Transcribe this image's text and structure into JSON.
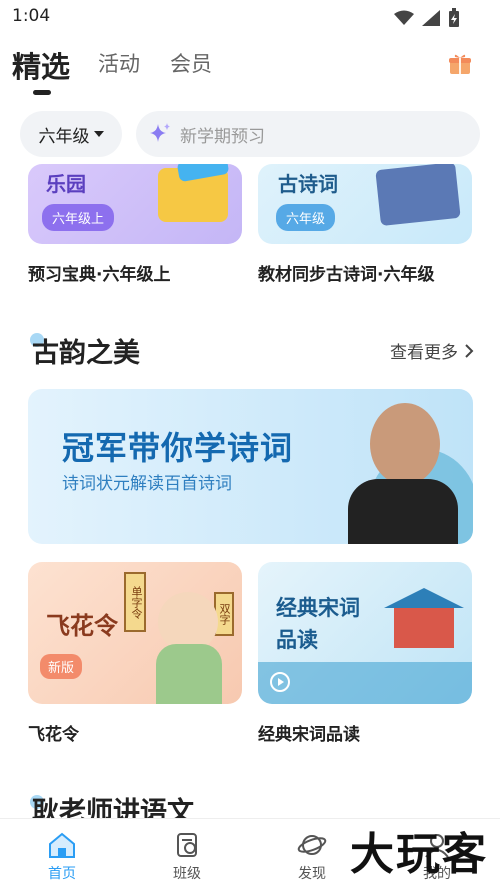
{
  "status": {
    "time": "1:04"
  },
  "topnav": {
    "tabs": [
      {
        "label": "精选",
        "active": true
      },
      {
        "label": "活动",
        "active": false
      },
      {
        "label": "会员",
        "active": false
      }
    ]
  },
  "filter": {
    "grade": "六年级",
    "search_placeholder": "新学期预习"
  },
  "top_cards": [
    {
      "banner_title": "乐园",
      "badge": "六年级上",
      "caption": "预习宝典·六年级上"
    },
    {
      "banner_title": "古诗词",
      "badge": "六年级",
      "caption": "教材同步古诗词·六年级"
    }
  ],
  "section_gu": {
    "title": "古韵之美",
    "more": "查看更多",
    "banner": {
      "title": "冠军带你学诗词",
      "subtitle": "诗词状元解读百首诗词"
    },
    "cards": [
      {
        "banner_title": "飞花令",
        "tag1": "单字令",
        "tag2": "双字",
        "badge": "新版",
        "caption": "飞花令"
      },
      {
        "banner_title_1": "经典宋词",
        "banner_title_2": "品读",
        "caption": "经典宋词品读"
      }
    ]
  },
  "section_geng": {
    "title": "耿老师讲语文"
  },
  "tabbar": {
    "items": [
      {
        "label": "首页",
        "active": true
      },
      {
        "label": "班级",
        "active": false
      },
      {
        "label": "发现",
        "active": false
      },
      {
        "label": "我的",
        "active": false
      }
    ]
  },
  "watermark": "大玩客",
  "colors": {
    "accent": "#2a9df4",
    "chip_bg": "#f1f3f6"
  }
}
